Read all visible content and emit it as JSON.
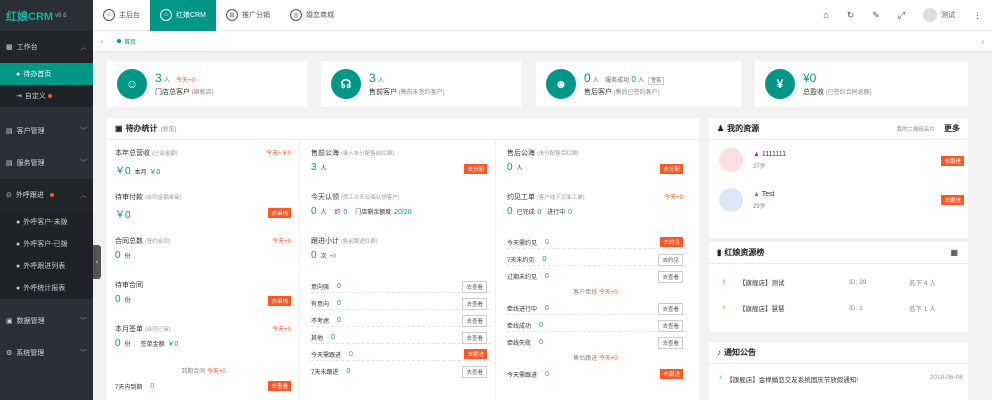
{
  "app": {
    "logo": "红娘CRM",
    "version": "v6.6"
  },
  "sidebar": {
    "workbench": "工作台",
    "sub1": [
      {
        "label": "待办首页"
      },
      {
        "label": "自定义"
      }
    ],
    "customer": "客户管理",
    "service": "服务管理",
    "outcall": "外呼跟进",
    "sub2": [
      {
        "label": "外呼客户-未拨"
      },
      {
        "label": "外呼客户-已拨"
      },
      {
        "label": "外呼跟进列表"
      },
      {
        "label": "外呼统计报表"
      }
    ],
    "data": "数据管理",
    "system": "系统管理"
  },
  "topbar": {
    "tabs": [
      {
        "label": "主后台"
      },
      {
        "label": "红娘CRM"
      },
      {
        "label": "推广分销"
      },
      {
        "label": "婚恋商城"
      }
    ],
    "user": "测试"
  },
  "pagetabs": {
    "home": "首页"
  },
  "stats": [
    {
      "num": "3",
      "unit": "人",
      "add": "今天+0",
      "label": "门店总客户",
      "sub": "(旗舰店)"
    },
    {
      "num": "3",
      "unit": "人",
      "label": "售前客户",
      "sub": "(售前未签约客户)"
    },
    {
      "num": "0",
      "unit": "人",
      "label2": "服务成功",
      "num2": "0",
      "unit2": "人",
      "btn": "查看",
      "label": "售后客户",
      "sub": "(售后已签约客户)"
    },
    {
      "num": "¥0",
      "label": "总盈收",
      "sub": "(已签约合同总额)"
    }
  ],
  "todo": {
    "title": "待办统计",
    "title_sub": "(总览)",
    "c1": {
      "rev_label": "本年总营收",
      "rev_sub": "(已会金额)",
      "rev_add": "今天+￥0",
      "rev_val": "￥0",
      "rev_month_lbl": "本月",
      "rev_month_val": "￥0",
      "pay_label": "待审付款",
      "pay_sub": "(合同金额未审)",
      "pay_val": "￥0",
      "pay_btn": "去审核",
      "ct_label": "合同总数",
      "ct_sub": "(签约合同)",
      "ct_add": "今天+0",
      "ct_val": "0",
      "ct_unit": "份",
      "rv_label": "待审合同",
      "rv_val": "0",
      "rv_unit": "份",
      "rv_btn": "去审核",
      "mo_label": "本月签单",
      "mo_sub": "(合同已审)",
      "mo_add": "今天+0",
      "mo_val": "0",
      "mo_unit": "份",
      "mo_amt_lbl": "签单金额",
      "mo_amt": "￥0",
      "due_label": "到期合同",
      "due_add": "今天+0",
      "due7": "7天内到期",
      "due7_val": "0",
      "due7_btn": "去查看"
    },
    "c2": {
      "pre_label": "售前公海",
      "pre_sub": "(录入未分配售前红娘)",
      "pre_val": "3",
      "pre_unit": "人",
      "pre_btn": "去分配",
      "claim_label": "今天认领",
      "claim_sub": "(员工今天公海认领客户)",
      "claim_val": "0",
      "claim_unit": "人",
      "claim_about": "约",
      "claim_about_val": "0",
      "claim_store": "门店剩余额度",
      "claim_store_val": "20/20",
      "fu_label": "跟进小计",
      "fu_sub": "(售前跟进红娘)",
      "fu_val": "0",
      "fu_unit": "次",
      "fu_add": "+0",
      "rows": [
        {
          "label": "意向强",
          "val": "0",
          "btn": "去查看"
        },
        {
          "label": "有意向",
          "val": "0",
          "btn": "去查看"
        },
        {
          "label": "不考虑",
          "val": "0",
          "btn": "去查看"
        },
        {
          "label": "其他",
          "val": "0",
          "btn": "去查看"
        },
        {
          "label": "今天需跟进",
          "val": "0",
          "btn": "去跟进"
        },
        {
          "label": "7天未跟进",
          "val": "0",
          "btn": "去查看"
        }
      ]
    },
    "c3": {
      "post_label": "售后公海",
      "post_sub": "(未分配售后红娘)",
      "post_val": "0",
      "post_unit": "人",
      "post_btn": "去分配",
      "meet_label": "约见工单",
      "meet_sub": "(客户线下见面工单)",
      "meet_add": "今天+0",
      "meet_val": "0",
      "meet_done_lbl": "已完成",
      "meet_done": "0",
      "meet_prog_lbl": "进行中",
      "meet_prog": "0",
      "rows_a": [
        {
          "label": "今天需约见",
          "val": "0",
          "btn": "去约见"
        },
        {
          "label": "7天未约见",
          "val": "0",
          "btn": "去约见"
        },
        {
          "label": "过期未约见",
          "val": "0",
          "btn": "去查看"
        }
      ],
      "line_title": "客户牵线",
      "line_add": "今天+0",
      "rows_b": [
        {
          "label": "牵线进行中",
          "val": "0",
          "btn": "去查看"
        },
        {
          "label": "牵线成功",
          "val": "0",
          "btn": "去查看"
        },
        {
          "label": "牵线失败",
          "val": "0",
          "btn": "去查看"
        }
      ],
      "track_title": "售后跟进",
      "track_add": "今天+0",
      "rows_c": [
        {
          "label": "今天需跟进",
          "val": "0",
          "btn": "去跟进"
        }
      ]
    }
  },
  "resources": {
    "title": "我的资源",
    "note": "我的二维码名片",
    "more": "更多",
    "items": [
      {
        "name": "1111111",
        "age": "27岁"
      },
      {
        "name": "Test",
        "age": "29岁"
      }
    ],
    "btn": "去跟进"
  },
  "rank": {
    "title": "红娘资源榜",
    "rows": [
      {
        "store": "【旗舰店】测试",
        "id": "ID: 39",
        "rank": "名下 4 人"
      },
      {
        "store": "【旗舰店】慧慧",
        "id": "ID: 1",
        "rank": "名下 1 人"
      }
    ]
  },
  "notice": {
    "title": "通知公告",
    "items": [
      {
        "text": "【旗舰店】金榉婚恋交友系统国庆节放假通知!",
        "date": "2019-06-08"
      }
    ]
  },
  "colors": {
    "primary": "#009688",
    "accent": "#ff5722",
    "sidebar": "#2b3036"
  }
}
